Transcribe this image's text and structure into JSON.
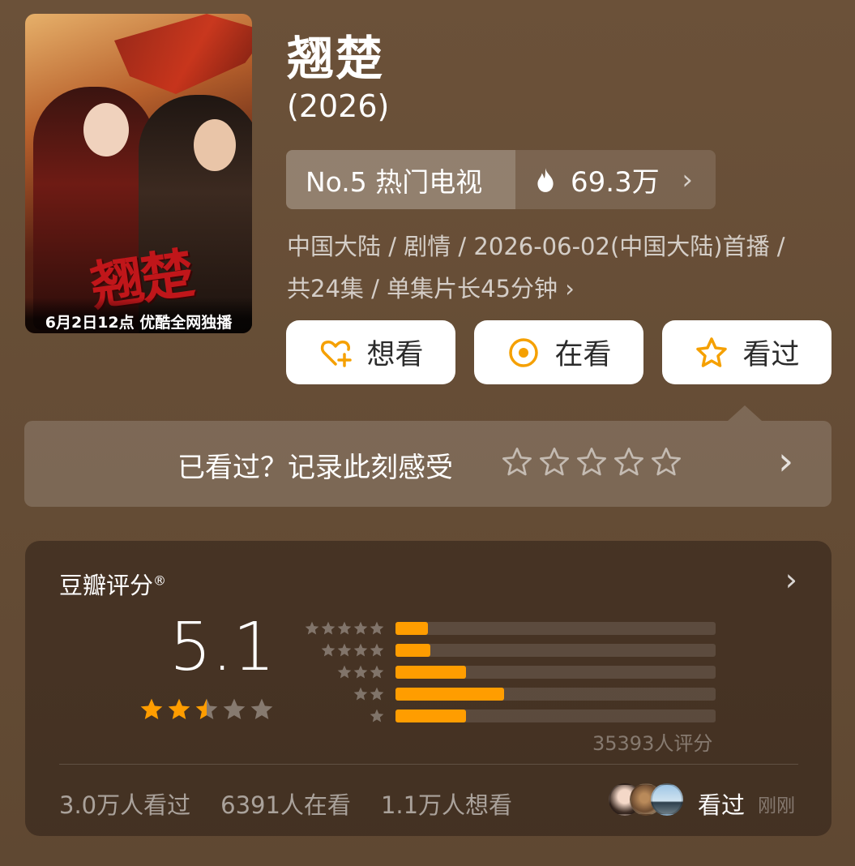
{
  "poster": {
    "calligraphy": "翘楚",
    "caption": "6月2日12点 优酷全网独播"
  },
  "title": "翘楚",
  "year": "(2026)",
  "rank": {
    "label": "No.5 热门电视",
    "heat": "69.3万",
    "chevron": "›"
  },
  "meta": {
    "line1": "中国大陆 / 剧情 / 2026-06-02(中国大陆)首播 /",
    "line2": "共24集 / 单集片长45分钟 ›"
  },
  "actions": {
    "want": "想看",
    "watching": "在看",
    "watched": "看过"
  },
  "record": {
    "text": "已看过？记录此刻感受",
    "chevron": "›"
  },
  "rating": {
    "label": "豆瓣评分",
    "mark": "®",
    "chevron": "›",
    "score": "5.1",
    "stars_value": 2.5,
    "distribution": [
      {
        "stars": 5,
        "fraction": 0.1
      },
      {
        "stars": 4,
        "fraction": 0.11
      },
      {
        "stars": 3,
        "fraction": 0.22
      },
      {
        "stars": 2,
        "fraction": 0.34
      },
      {
        "stars": 1,
        "fraction": 0.22
      }
    ],
    "count": "35393人评分"
  },
  "stats": {
    "watched": "3.0万人看过",
    "watching": "6391人在看",
    "want": "1.1万人想看"
  },
  "friends": {
    "status": "看过",
    "time": "刚刚"
  },
  "colors": {
    "accent": "#ff9d00",
    "background": "#6a5038"
  }
}
